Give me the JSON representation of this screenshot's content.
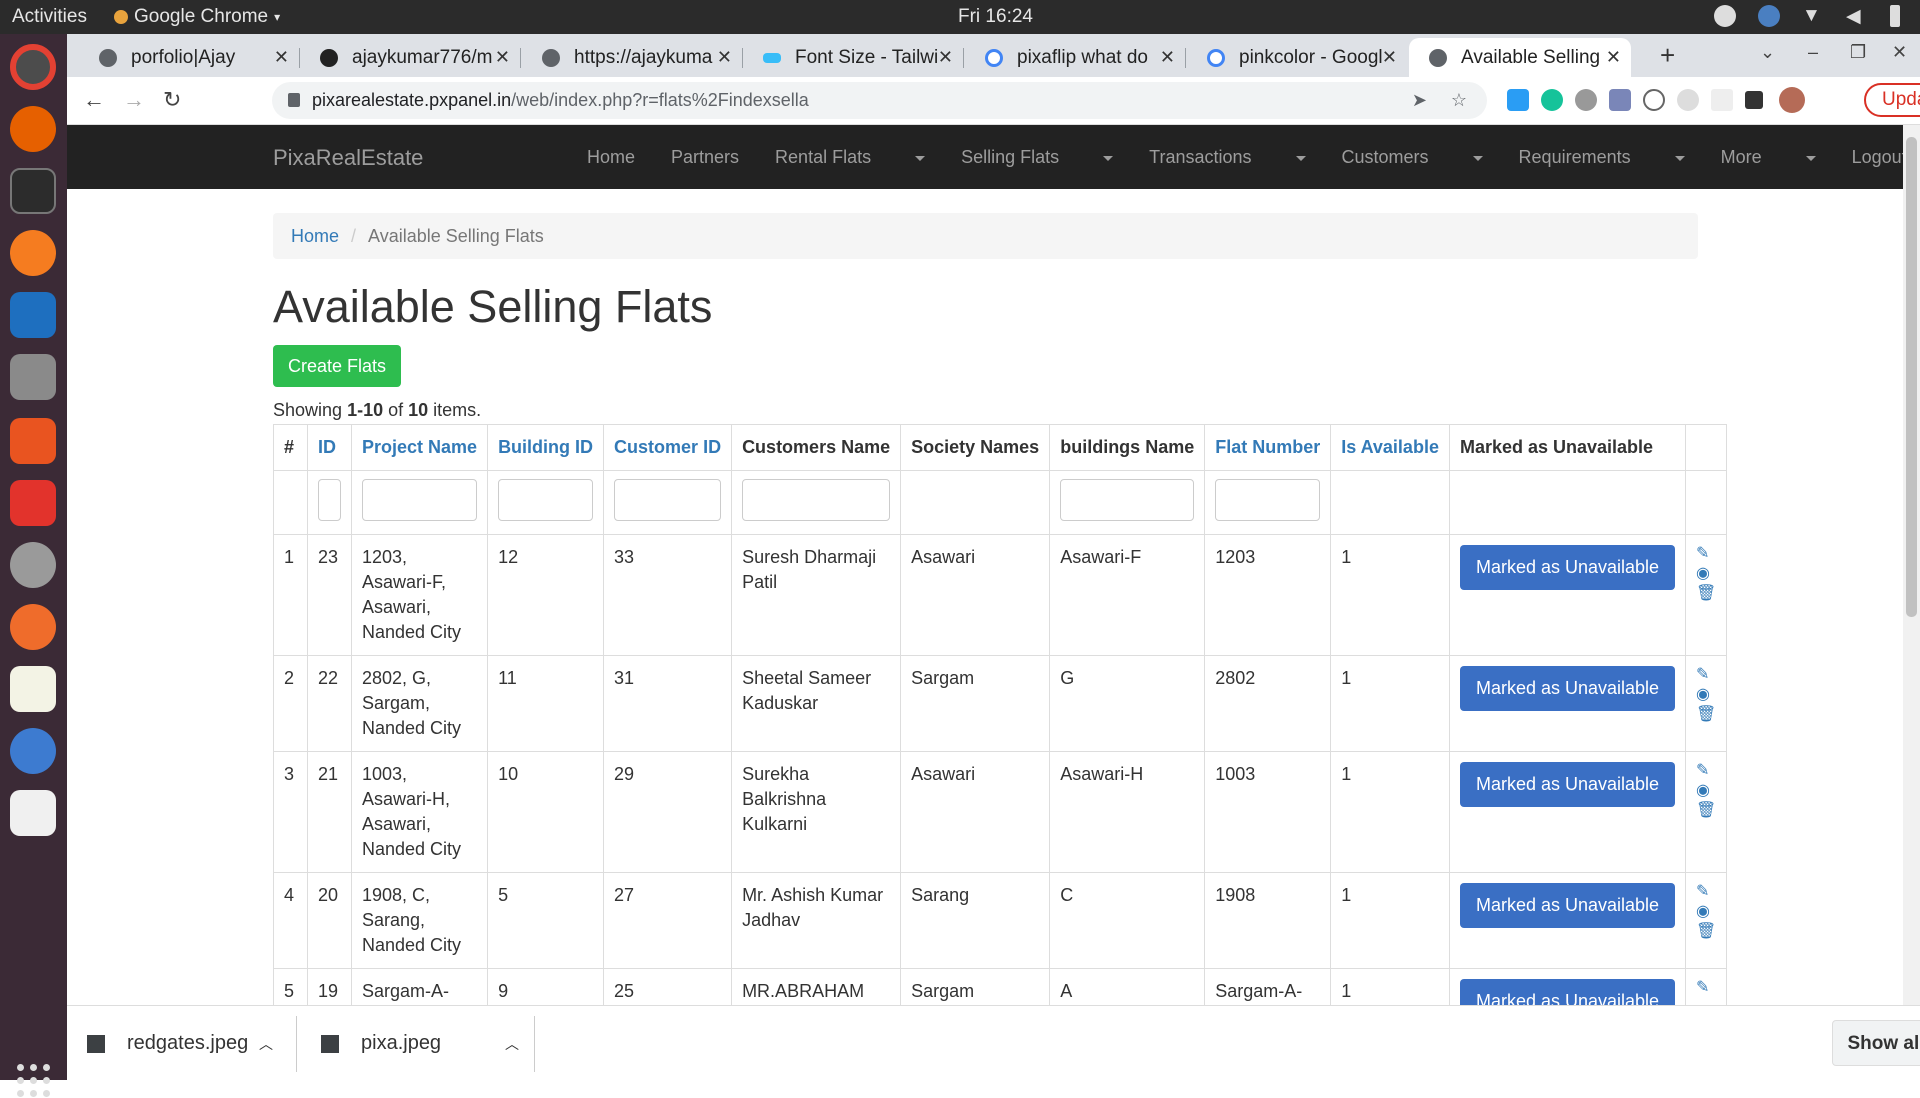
{
  "system": {
    "activities": "Activities",
    "app_name": "Google Chrome",
    "clock": "Fri 16:24"
  },
  "browser": {
    "tabs": [
      {
        "title": "porfolio|Ajay"
      },
      {
        "title": "ajaykumar776/m"
      },
      {
        "title": "https://ajaykuma"
      },
      {
        "title": "Font Size - Tailwi"
      },
      {
        "title": "pixaflip what do"
      },
      {
        "title": "pinkcolor - Googl"
      },
      {
        "title": "Available Selling"
      }
    ],
    "url_host": "pixarealestate.pxpanel.in",
    "url_path": "/web/index.php?r=flats%2Findexsella",
    "update_label": "Update"
  },
  "site": {
    "brand": "PixaRealEstate",
    "nav": [
      {
        "label": "Home"
      },
      {
        "label": "Partners"
      },
      {
        "label": "Rental Flats"
      },
      {
        "label": "Selling Flats"
      },
      {
        "label": "Transactions"
      },
      {
        "label": "Customers"
      },
      {
        "label": "Requirements"
      },
      {
        "label": "More"
      },
      {
        "label": "Logout (broker)"
      }
    ]
  },
  "breadcrumb": {
    "home": "Home",
    "current": "Available Selling Flats"
  },
  "page_title": "Available Selling Flats",
  "create_button": "Create Flats",
  "summary": {
    "prefix": "Showing ",
    "range": "1-10",
    "mid": " of ",
    "total": "10",
    "suffix": " items."
  },
  "table": {
    "headers": [
      "#",
      "ID",
      "Project Name",
      "Building ID",
      "Customer ID",
      "Customers Name",
      "Society Names",
      "buildings Name",
      "Flat Number",
      "Is Available",
      "Marked as Unavailable"
    ],
    "rows": [
      {
        "n": "1",
        "id": "23",
        "project": "1203, Asawari-F, Asawari, Nanded City",
        "building_id": "12",
        "customer_id": "33",
        "customer": "Suresh Dharmaji Patil",
        "society": "Asawari",
        "building": "Asawari-F",
        "flat": "1203",
        "available": "1",
        "action": "Marked as Unavailable"
      },
      {
        "n": "2",
        "id": "22",
        "project": "2802, G, Sargam, Nanded City",
        "building_id": "11",
        "customer_id": "31",
        "customer": "Sheetal Sameer Kaduskar",
        "society": "Sargam",
        "building": "G",
        "flat": "2802",
        "available": "1",
        "action": "Marked as Unavailable"
      },
      {
        "n": "3",
        "id": "21",
        "project": "1003, Asawari-H, Asawari, Nanded City",
        "building_id": "10",
        "customer_id": "29",
        "customer": "Surekha Balkrishna Kulkarni",
        "society": "Asawari",
        "building": "Asawari-H",
        "flat": "1003",
        "available": "1",
        "action": "Marked as Unavailable"
      },
      {
        "n": "4",
        "id": "20",
        "project": "1908, C, Sarang, Nanded City",
        "building_id": "5",
        "customer_id": "27",
        "customer": "Mr. Ashish Kumar Jadhav",
        "society": "Sarang",
        "building": "C",
        "flat": "1908",
        "available": "1",
        "action": "Marked as Unavailable"
      },
      {
        "n": "5",
        "id": "19",
        "project": "Sargam-A-",
        "building_id": "9",
        "customer_id": "25",
        "customer": "MR.ABRAHAM",
        "society": "Sargam",
        "building": "A",
        "flat": "Sargam-A-",
        "available": "1",
        "action": "Marked as Unavailable"
      }
    ]
  },
  "downloads": {
    "items": [
      {
        "name": "redgates.jpeg"
      },
      {
        "name": "pixa.jpeg"
      }
    ],
    "show_all": "Show all"
  }
}
